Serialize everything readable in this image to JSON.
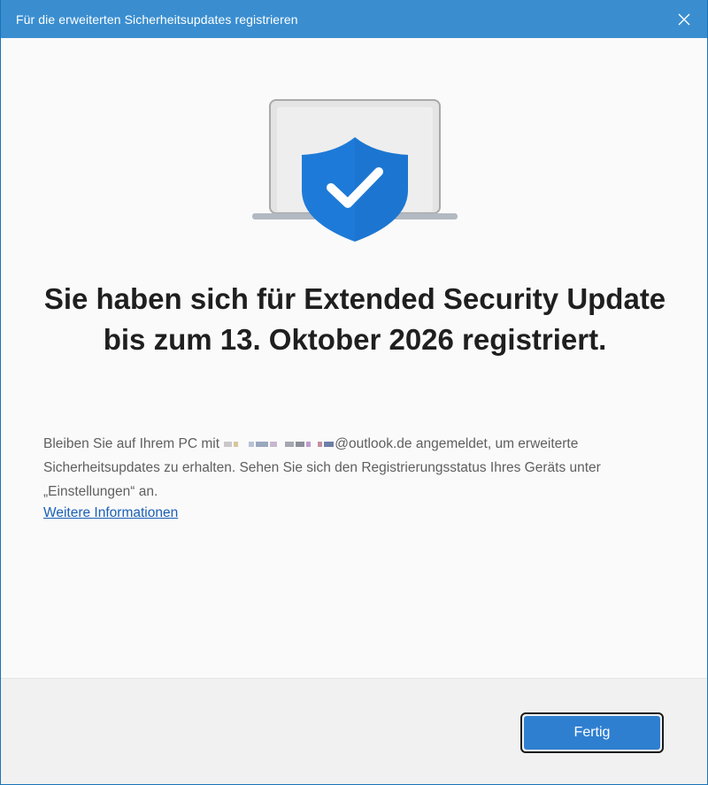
{
  "window": {
    "title": "Für die erweiterten Sicherheitsupdates registrieren",
    "close_icon": "close-icon"
  },
  "main": {
    "illustration_icon": "laptop-shield-check-icon",
    "heading": "Sie haben sich für Extended Security Update bis zum 13. Oktober 2026 registriert.",
    "body_prefix": "Bleiben Sie auf Ihrem PC mit",
    "email_domain": "@outlook.de",
    "body_suffix": "angemeldet, um erweiterte Sicherheitsupdates zu erhalten. Sehen Sie sich den Registrierungsstatus Ihres Geräts unter „Einstellungen“ an.",
    "link_label": "Weitere Informationen"
  },
  "footer": {
    "done_label": "Fertig"
  },
  "colors": {
    "titlebar": "#3a8ed0",
    "accent": "#2f7fd0",
    "shield": "#1e7ad8",
    "link": "#1a5fb4"
  }
}
